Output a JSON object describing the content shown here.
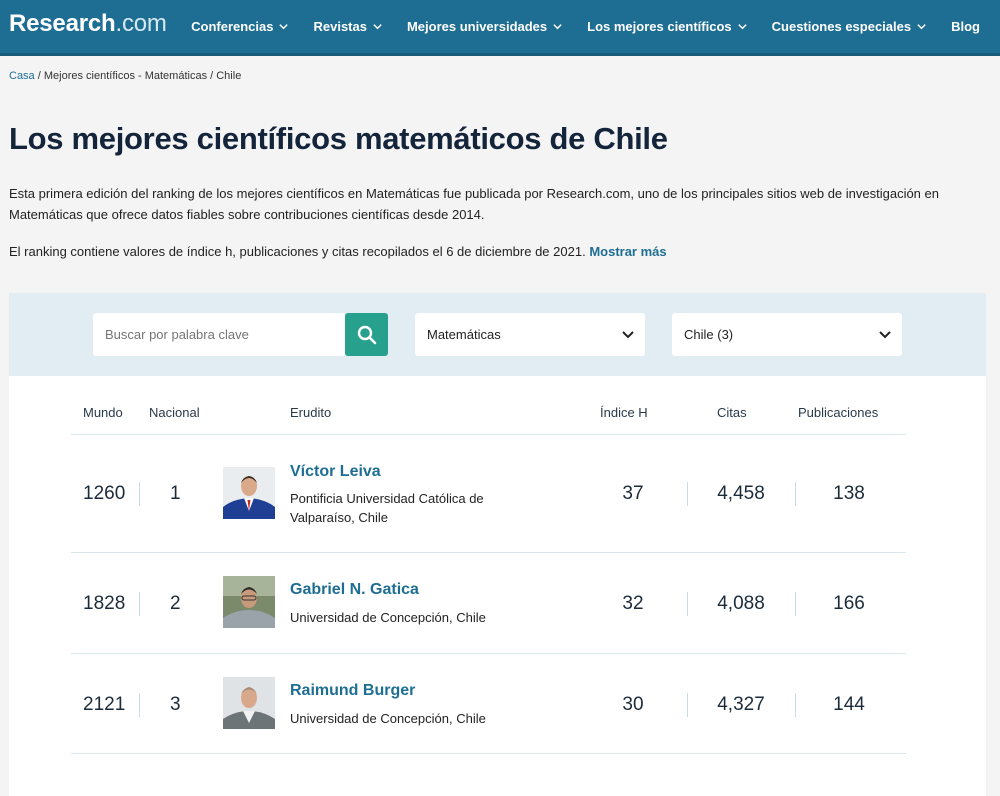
{
  "header": {
    "logo_brand": "Research",
    "logo_tld": ".com",
    "nav": [
      {
        "label": "Conferencias"
      },
      {
        "label": "Revistas"
      },
      {
        "label": "Mejores universidades"
      },
      {
        "label": "Los mejores científicos"
      },
      {
        "label": "Cuestiones especiales"
      }
    ],
    "blog": "Blog"
  },
  "breadcrumb": {
    "home": "Casa",
    "rest": " / Mejores científicos - Matemáticas / Chile"
  },
  "title": "Los mejores científicos matemáticos de Chile",
  "intro": "Esta primera edición del ranking de los mejores científicos en Matemáticas fue publicada por Research.com, uno de los principales sitios web de investigación en Matemáticas que ofrece datos fiables sobre contribuciones científicas desde 2014.",
  "intro2": "El ranking contiene valores de índice h, publicaciones y citas recopilados el 6 de diciembre de 2021.",
  "show_more": "Mostrar más",
  "filters": {
    "search_placeholder": "Buscar por palabra clave",
    "field": "Matemáticas",
    "country": "Chile (3)"
  },
  "table": {
    "headers": {
      "world": "Mundo",
      "national": "Nacional",
      "scholar": "Erudito",
      "hindex": "Índice H",
      "citations": "Citas",
      "publications": "Publicaciones"
    },
    "rows": [
      {
        "world": "1260",
        "national": "1",
        "name": "Víctor Leiva",
        "institution": "Pontificia Universidad Católica de Valparaíso, Chile",
        "hindex": "37",
        "citations": "4,458",
        "publications": "138"
      },
      {
        "world": "1828",
        "national": "2",
        "name": "Gabriel N. Gatica",
        "institution": "Universidad de Concepción, Chile",
        "hindex": "32",
        "citations": "4,088",
        "publications": "166"
      },
      {
        "world": "2121",
        "national": "3",
        "name": "Raimund Burger",
        "institution": "Universidad de Concepción, Chile",
        "hindex": "30",
        "citations": "4,327",
        "publications": "144"
      }
    ]
  },
  "colors": {
    "header_bg": "#1e6e93",
    "accent_button": "#27a18d",
    "link": "#1e6e93"
  }
}
